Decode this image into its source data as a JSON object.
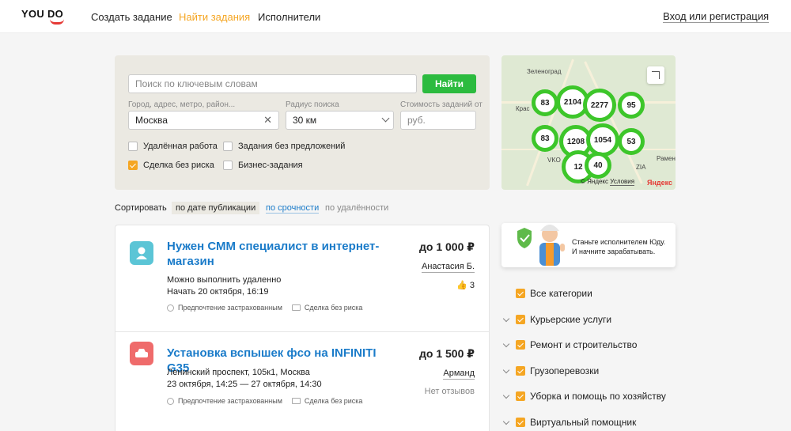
{
  "header": {
    "logo_text": "YOU DO",
    "nav": [
      "Создать задание",
      "Найти задания",
      "Исполнители"
    ],
    "active_nav_index": 1,
    "login_label": "Вход или регистрация"
  },
  "search": {
    "keyword_placeholder": "Поиск по ключевым словам",
    "find_button": "Найти",
    "city_label": "Город, адрес, метро, район...",
    "city_value": "Москва",
    "radius_label": "Радиус поиска",
    "radius_value": "30 км",
    "cost_label": "Стоимость заданий от",
    "cost_placeholder": "руб.",
    "checkboxes": [
      {
        "label": "Удалённая работа",
        "checked": false
      },
      {
        "label": "Задания без предложений",
        "checked": false
      },
      {
        "label": "Сделка без риска",
        "checked": true
      },
      {
        "label": "Бизнес-задания",
        "checked": false
      }
    ]
  },
  "map": {
    "clusters": [
      "83",
      "2104",
      "2277",
      "95",
      "83",
      "1208",
      "1054",
      "53",
      "12",
      "40"
    ],
    "labels": [
      "Зеленоград",
      "Крас",
      "VKO",
      "ZIA",
      "Рамен"
    ],
    "footer_text": "© Яндекс",
    "footer_link": "Условия",
    "brand": "Яндекс"
  },
  "sort": {
    "label": "Сортировать",
    "options": [
      "по дате публикации",
      "по срочности",
      "по удалённости"
    ]
  },
  "tasks": [
    {
      "title": "Нужен СММ специалист в интернет-магазин",
      "price": "до 1 000 ₽",
      "author": "Анастасия Б.",
      "likes": "3",
      "line1": "Можно выполнить удаленно",
      "line2": "Начать 20 октября, 16:19",
      "tags": [
        "Предпочтение застрахованным",
        "Сделка без риска"
      ],
      "icon_color": "#5bc5d6"
    },
    {
      "title": "Установка вспышек фсо на INFINITI G35",
      "price": "до 1 500 ₽",
      "author": "Арманд",
      "reviews": "Нет отзывов",
      "line1": "Ленинский проспект, 105к1, Москва",
      "line2": "23 октября, 14:25 — 27 октября, 14:30",
      "tags": [
        "Предпочтение застрахованным",
        "Сделка без риска"
      ],
      "icon_color": "#ef6b6b"
    }
  ],
  "promo": {
    "text": "Станьте исполнителем Юду. И начните зарабатывать."
  },
  "categories": [
    {
      "label": "Все категории",
      "checked": true,
      "expandable": false
    },
    {
      "label": "Курьерские услуги",
      "checked": true,
      "expandable": true
    },
    {
      "label": "Ремонт и строительство",
      "checked": true,
      "expandable": true
    },
    {
      "label": "Грузоперевозки",
      "checked": true,
      "expandable": true
    },
    {
      "label": "Уборка и помощь по хозяйству",
      "checked": true,
      "expandable": true
    },
    {
      "label": "Виртуальный помощник",
      "checked": true,
      "expandable": true
    }
  ],
  "colors": {
    "accent": "#f5a623",
    "link": "#1a7bc9",
    "button": "#2cbb3f",
    "cluster": "#3dc62a"
  }
}
